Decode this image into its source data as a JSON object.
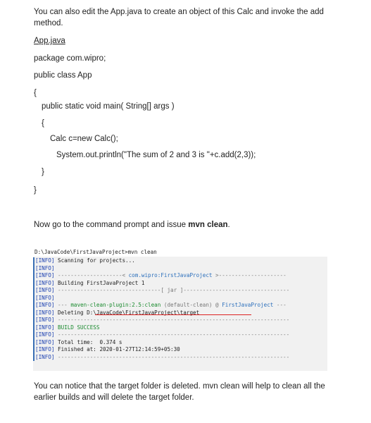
{
  "doc": {
    "intro": "You can also edit the App.java to create an object of this Calc and invoke the add method.",
    "file_label": "App.java",
    "code": [
      "package com.wipro;",
      "public class App",
      "{",
      "public static void main( String[] args )",
      "{",
      "Calc c=new Calc();",
      "System.out.println(\"The sum of 2 and 3 is \"+c.add(2,3));",
      "}",
      "}"
    ],
    "now_prefix": "Now go to the command prompt and issue ",
    "now_cmd": "mvn clean",
    "now_suffix": ".",
    "outro": "You can notice that the target folder is deleted. mvn clean will help to clean all the earlier builds and will delete the target folder."
  },
  "console": {
    "prompt": "D:\\JavaCode\\FirstJavaProject>mvn clean",
    "tag": "[INFO]",
    "scanning": "Scanning for projects...",
    "divider": "------------------------------------------------------------------------",
    "project_left": "--------------------< ",
    "project_id": "com.wipro:FirstJavaProject",
    "project_right": " >---------------------",
    "building": "Building FirstJavaProject 1",
    "packaging_left": "--------------------------------[ ",
    "packaging": "jar",
    "packaging_right": " ]---------------------------------",
    "plugin_prefix": "--- ",
    "plugin_name": "maven-clean-plugin:2.5:clean",
    "plugin_mid": " (default-clean) @ ",
    "plugin_project": "FirstJavaProject",
    "plugin_suffix": " ---",
    "deleting": "Deleting D:\\JavaCode\\FirstJavaProject\\target",
    "success": "BUILD SUCCESS",
    "total_time": "Total time:  0.374 s",
    "finished": "Finished at: 2020-01-27T12:14:59+05:30"
  },
  "colors": {
    "info_tag": "#1a3fb0",
    "plugin_green": "#1a8a2e",
    "project_blue": "#2a6ebb",
    "underline_red": "#dd2222",
    "console_bg": "#f1f1f1"
  }
}
